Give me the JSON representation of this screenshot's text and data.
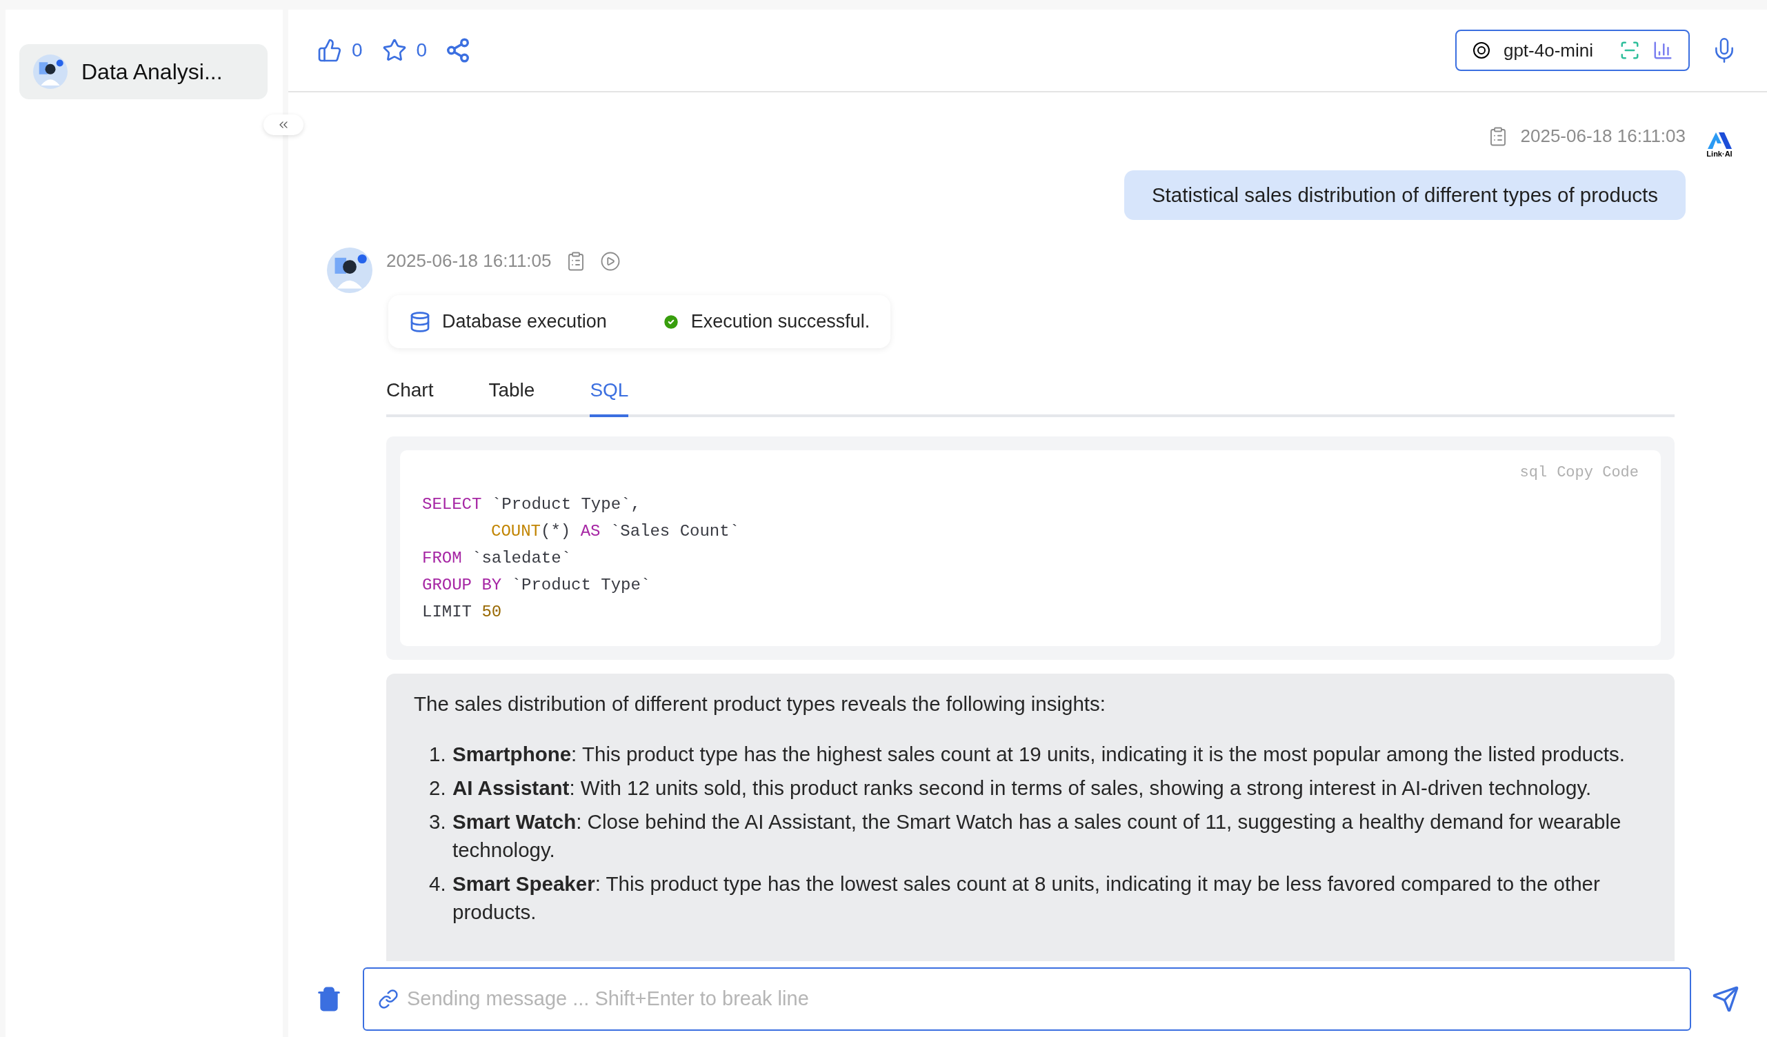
{
  "sidebar": {
    "items": [
      {
        "label": "Data Analysi...",
        "selected": true
      }
    ]
  },
  "toolbar": {
    "likes": "0",
    "stars": "0",
    "model": {
      "name": "gpt-4o-mini"
    }
  },
  "messages": [
    {
      "kind": "user",
      "time": "2025-06-18 16:11:03",
      "text": "Statistical sales distribution of different types of products",
      "logo_text": "Link·AI"
    },
    {
      "kind": "assistant",
      "time": "2025-06-18 16:11:05",
      "status": {
        "label": "Database execution",
        "result": "Execution successful."
      },
      "tabs": [
        {
          "label": "Chart",
          "selected": false
        },
        {
          "label": "Table",
          "selected": false
        },
        {
          "label": "SQL",
          "selected": true
        }
      ],
      "code": {
        "language": "sql",
        "copy_label": "Copy Code",
        "lines": [
          {
            "indented": false,
            "tokens": [
              {
                "kind": "keyword",
                "text": "SELECT"
              },
              {
                "kind": "plain",
                "text": " `Product Type`,"
              }
            ]
          },
          {
            "indented": true,
            "tokens": [
              {
                "kind": "function",
                "text": "COUNT"
              },
              {
                "kind": "plain",
                "text": "(*) "
              },
              {
                "kind": "keyword",
                "text": "AS"
              },
              {
                "kind": "plain",
                "text": " `Sales Count`"
              }
            ]
          },
          {
            "indented": false,
            "tokens": [
              {
                "kind": "keyword",
                "text": "FROM"
              },
              {
                "kind": "plain",
                "text": " `saledate`"
              }
            ]
          },
          {
            "indented": false,
            "tokens": [
              {
                "kind": "keyword",
                "text": "GROUP BY"
              },
              {
                "kind": "plain",
                "text": " `Product Type`"
              }
            ]
          },
          {
            "indented": false,
            "tokens": [
              {
                "kind": "plain",
                "text": "LIMIT "
              },
              {
                "kind": "number",
                "text": "50"
              }
            ]
          }
        ]
      },
      "answer": {
        "intro": "The sales distribution of different product types reveals the following insights:",
        "items": [
          {
            "number": "1.",
            "text": "**Smartphone**: This product type has the highest sales count at 19 units, indicating it is the most popular among the listed products."
          },
          {
            "number": "2.",
            "text": "**AI Assistant**: With 12 units sold, this product ranks second in terms of sales, showing a strong interest in AI-driven technology."
          },
          {
            "number": "3.",
            "text": "**Smart Watch**: Close behind the AI Assistant, the Smart Watch has a sales count of 11, suggesting a healthy demand for wearable technology."
          },
          {
            "number": "4.",
            "text": "**Smart Speaker**: This product type has the lowest sales count at 8 units, indicating it may be less favored compared to the other products."
          }
        ]
      }
    }
  ],
  "composer": {
    "placeholder": "Sending message ... Shift+Enter to break line"
  }
}
